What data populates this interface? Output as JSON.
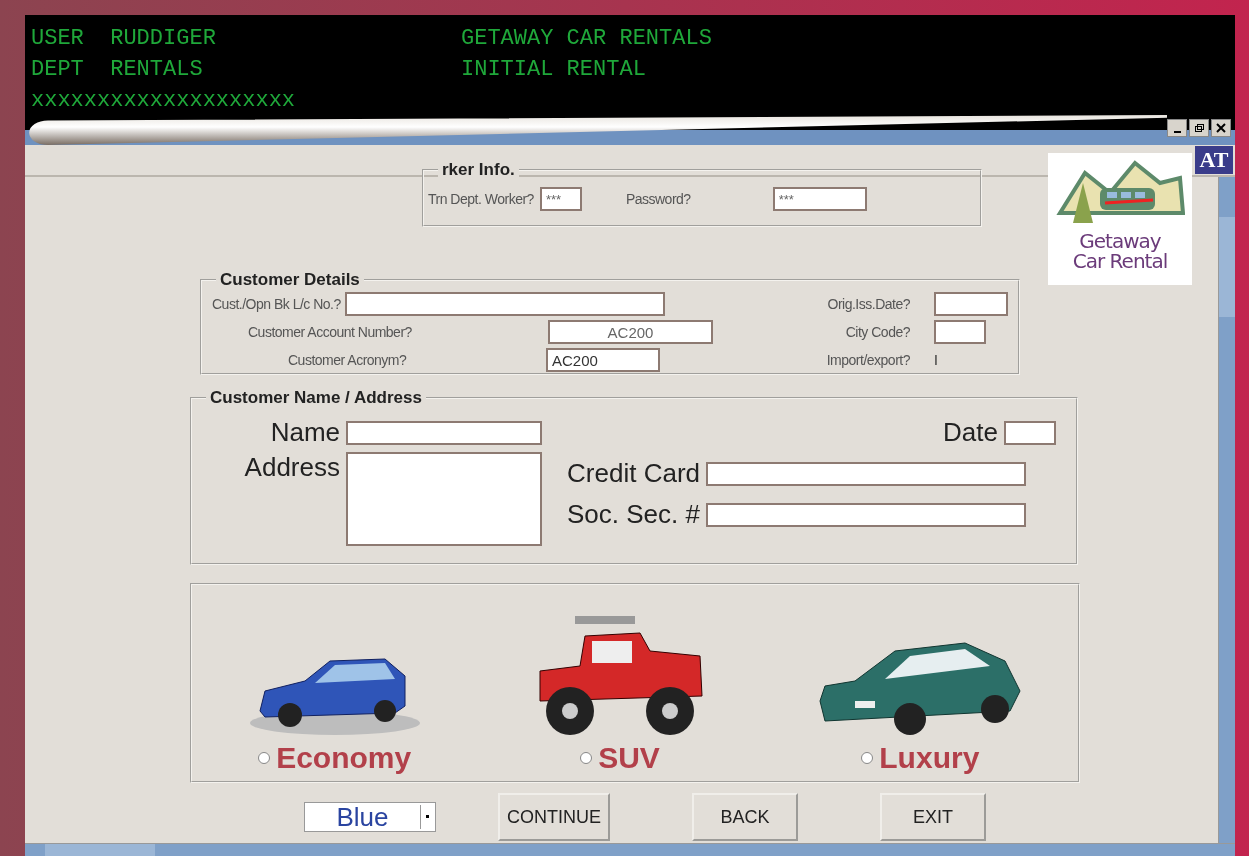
{
  "terminal": {
    "lines": [
      {
        "left": "USER  RUDDIGER",
        "right": "GETAWAY CAR RENTALS"
      },
      {
        "left": "DEPT  RENTALS",
        "right": "INITIAL RENTAL"
      },
      {
        "left": "xxxxxxxxxxxxxxxxxxxx"
      }
    ]
  },
  "window": {
    "badge": "AT"
  },
  "worker_info": {
    "title": "rker Info.",
    "fields": [
      {
        "label": "Trn Dept. Worker?",
        "value": "***"
      },
      {
        "label": "Password?",
        "value": "***"
      }
    ]
  },
  "logo": {
    "lines": [
      "Getaway",
      "Car Rental"
    ]
  },
  "customer_details": {
    "title": "Customer Details",
    "left_fields": [
      {
        "label": "Cust./Opn Bk L/c No.?"
      },
      {
        "label": "Customer Account Number?",
        "value": "AC200"
      },
      {
        "label": "Customer Acronym?",
        "value": "AC200"
      }
    ],
    "right_fields": [
      {
        "label": "Orig.Iss.Date?",
        "kind": "field"
      },
      {
        "label": "City Code?",
        "kind": "field"
      },
      {
        "label": "Import/export?",
        "value": "I",
        "kind": "text"
      }
    ]
  },
  "customer_name_address": {
    "title": "Customer Name / Address",
    "name_label": "Name",
    "address_label": "Address",
    "date_label": "Date",
    "credit_card_label": "Credit Card",
    "ssn_label": "Soc. Sec. #"
  },
  "car_types": [
    {
      "label": "Economy",
      "selected": false,
      "kind": "hatchback"
    },
    {
      "label": "SUV",
      "selected": false,
      "kind": "jeep"
    },
    {
      "label": "Luxury",
      "selected": false,
      "kind": "sedan"
    }
  ],
  "color_select": {
    "value": "Blue"
  },
  "buttons": [
    "CONTINUE",
    "BACK",
    "EXIT"
  ]
}
